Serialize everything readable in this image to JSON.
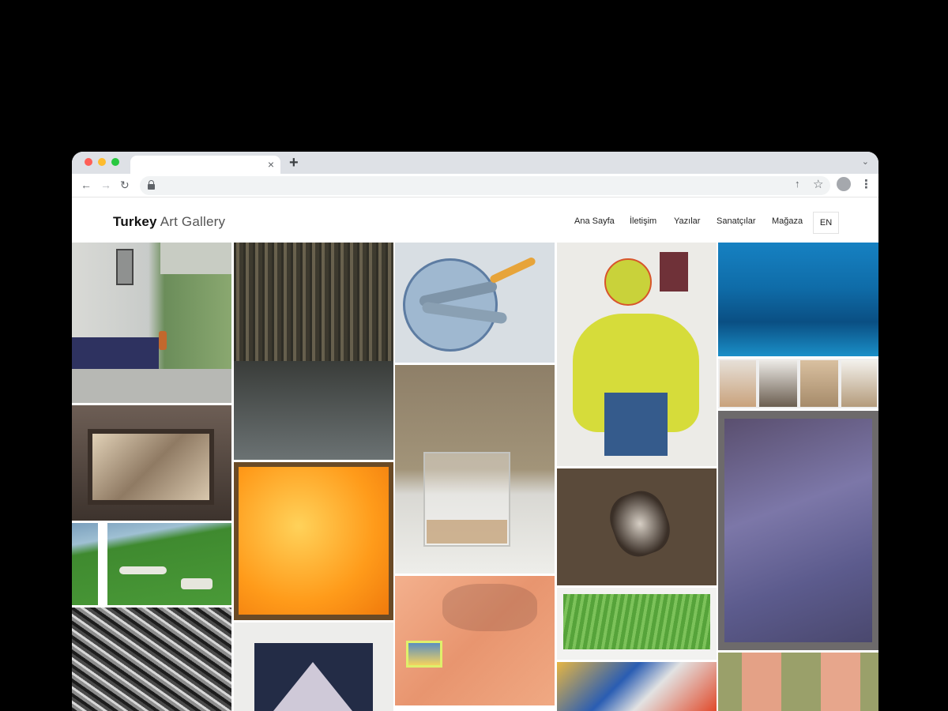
{
  "browser": {
    "tab_close": "×",
    "new_tab": "+",
    "tab_menu": "⌄",
    "back": "←",
    "forward": "→",
    "reload": "↻",
    "share": "↑",
    "bookmark": "☆",
    "menu": "⋮"
  },
  "site": {
    "logo_strong": "Turkey",
    "logo_light": "Art Gallery",
    "menu": [
      "Ana Sayfa",
      "İletişim",
      "Yazılar",
      "Sanatçılar",
      "Mağaza"
    ],
    "language": "EN"
  },
  "colors": {
    "accent_text": "#222222",
    "traffic_red": "#fe5f57",
    "traffic_yellow": "#febc2e",
    "traffic_green": "#28c840"
  },
  "gallery": {
    "artworks": [
      {
        "depicts": "street-wall-tree-painting"
      },
      {
        "depicts": "dark-forest-painting"
      },
      {
        "depicts": "fish-on-plate-painting"
      },
      {
        "depicts": "yellow-figure-abstract-painting"
      },
      {
        "depicts": "blue-landscape-painting"
      },
      {
        "depicts": "woodshed-painting"
      },
      {
        "depicts": "orange-texture-painting"
      },
      {
        "depicts": "glass-still-life-painting"
      },
      {
        "depicts": "bird-on-brown-painting"
      },
      {
        "depicts": "sculpture-photo-collage"
      },
      {
        "depicts": "green-hills-sheep-painting"
      },
      {
        "depicts": "purple-abstract-painting"
      },
      {
        "depicts": "silver-foil-texture-artwork"
      },
      {
        "depicts": "mountain-print-artwork"
      },
      {
        "depicts": "peach-sunset-painting"
      },
      {
        "depicts": "green-grass-painting"
      },
      {
        "depicts": "colorful-collage-artwork"
      },
      {
        "depicts": "peach-figures-painting"
      }
    ]
  }
}
